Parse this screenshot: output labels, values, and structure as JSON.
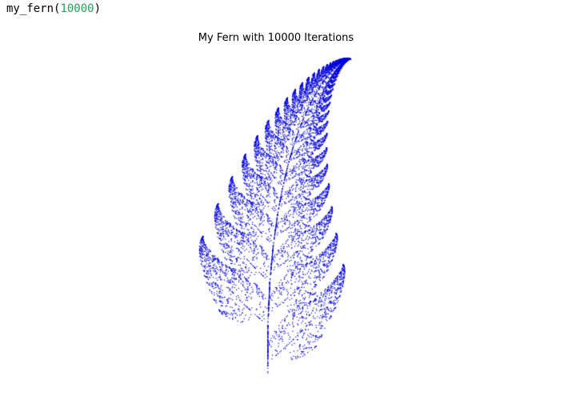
{
  "cell": {
    "func": "my_fern",
    "open": "(",
    "arg": "10000",
    "close": ")"
  },
  "chart_data": {
    "type": "scatter",
    "title": "My Fern with 10000 Iterations",
    "iterations": 10000,
    "series": [
      {
        "color": "#0000dd",
        "marker_size": 1
      }
    ],
    "axis": "off"
  }
}
